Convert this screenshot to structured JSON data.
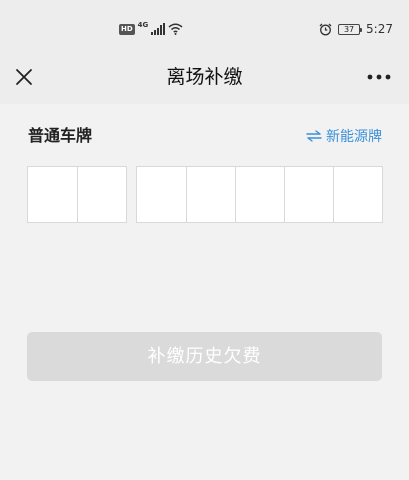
{
  "status_bar": {
    "hd_label": "HD",
    "network_label": "4G",
    "battery_level": "37",
    "time": "5:27"
  },
  "header": {
    "title": "离场补缴",
    "close_icon": "close-icon",
    "more_icon": "more-icon"
  },
  "plate": {
    "type_label": "普通车牌",
    "switch_label": "新能源牌",
    "switch_icon": "swap-arrows-icon",
    "left_cell_count": 2,
    "right_cell_count": 5
  },
  "actions": {
    "submit_label": "补缴历史欠费"
  },
  "colors": {
    "page_bg": "#ededed",
    "content_bg": "#f2f2f2",
    "link_blue": "#3b8fd9",
    "disabled_button": "#dadada"
  }
}
